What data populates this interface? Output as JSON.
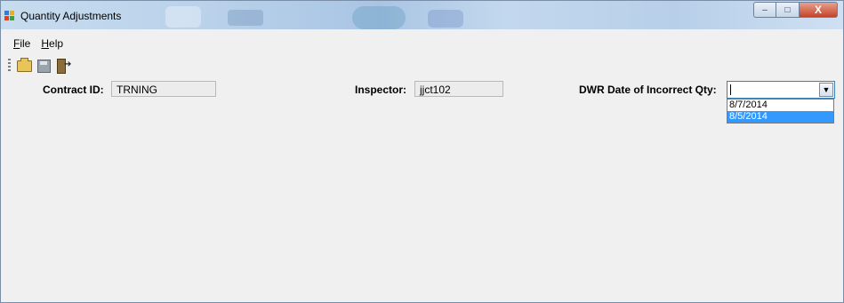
{
  "window": {
    "title": "Quantity Adjustments",
    "controls": {
      "minimize": "–",
      "maximize": "□",
      "close": "X"
    }
  },
  "menu": [
    {
      "label": "File",
      "mnemonic": "F",
      "rest": "ile"
    },
    {
      "label": "Help",
      "mnemonic": "H",
      "rest": "elp"
    }
  ],
  "toolbar": {
    "buttons": [
      "open-folder-icon",
      "save-disk-icon",
      "exit-door-icon"
    ]
  },
  "form": {
    "contract_label": "Contract ID:",
    "contract_value": "TRNING",
    "inspector_label": "Inspector:",
    "inspector_value": "jjct102",
    "dwr_label": "DWR Date of Incorrect Qty:",
    "dwr_value": "",
    "dwr_options": [
      "8/7/2014",
      "8/5/2014"
    ],
    "dwr_highlighted_index": 1
  },
  "colors": {
    "highlight": "#3399ff",
    "window_bg": "#f0f0f0"
  }
}
